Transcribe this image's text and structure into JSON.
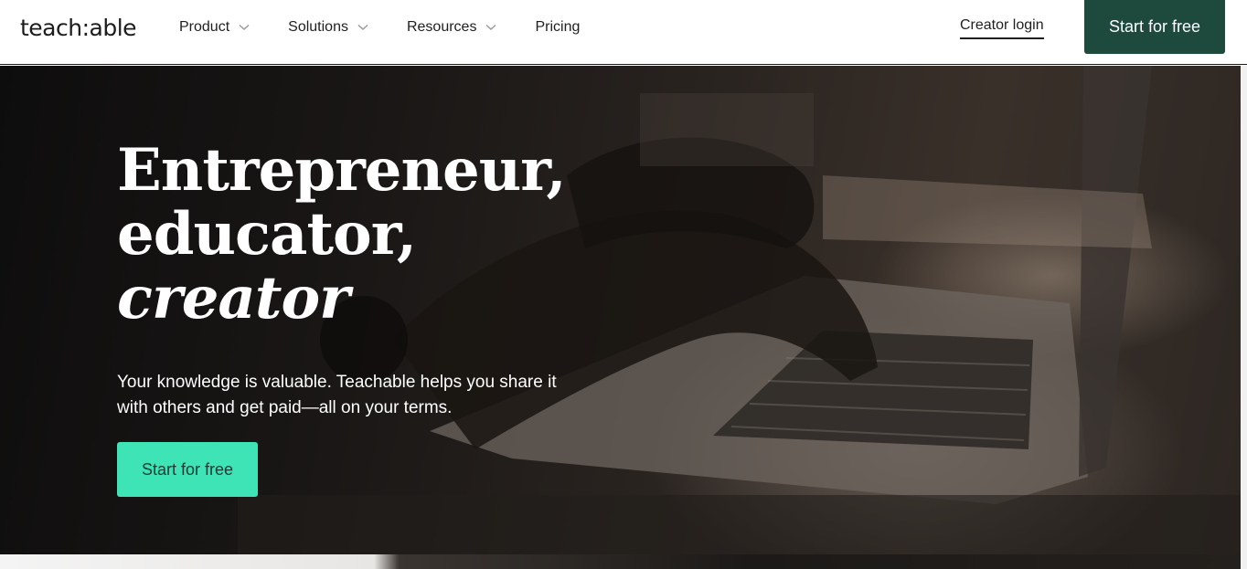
{
  "header": {
    "logo": "teach:able",
    "nav": [
      {
        "label": "Product",
        "has_dropdown": true,
        "icon": "chevron-down-icon"
      },
      {
        "label": "Solutions",
        "has_dropdown": true,
        "icon": "chevron-down-icon"
      },
      {
        "label": "Resources",
        "has_dropdown": true,
        "icon": "chevron-down-icon"
      },
      {
        "label": "Pricing",
        "has_dropdown": false
      }
    ],
    "login_label": "Creator login",
    "cta_label": "Start for free"
  },
  "hero": {
    "headline_line1": "Entrepreneur,",
    "headline_line2": "educator,",
    "headline_line3": "creator",
    "subtext": "Your knowledge is valuable. Teachable helps you share it with others and get paid—all on your terms.",
    "cta_label": "Start for free"
  },
  "colors": {
    "header_cta_bg": "#1d4a3d",
    "hero_cta_bg": "#3ee4b6",
    "text_dark": "#1f1f1f"
  }
}
